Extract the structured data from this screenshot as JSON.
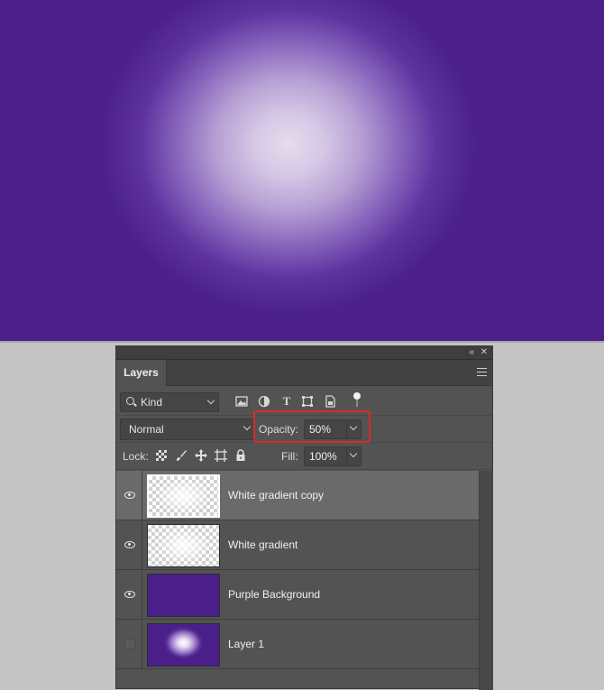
{
  "panel": {
    "tab_label": "Layers",
    "filter": {
      "kind_label": "Kind"
    },
    "blend": {
      "mode": "Normal",
      "opacity_label": "Opacity:",
      "opacity_value": "50%"
    },
    "lock": {
      "label": "Lock:",
      "fill_label": "Fill:",
      "fill_value": "100%"
    },
    "layers": [
      {
        "name": "White gradient copy",
        "visible": true,
        "selected": true,
        "thumbnail": "transparent-white-gradient"
      },
      {
        "name": "White gradient",
        "visible": true,
        "selected": false,
        "thumbnail": "transparent-white-gradient"
      },
      {
        "name": "Purple Background",
        "visible": true,
        "selected": false,
        "thumbnail": "solid-purple"
      },
      {
        "name": "Layer 1",
        "visible": false,
        "selected": false,
        "thumbnail": "purple-radial-glow"
      }
    ]
  },
  "colors": {
    "canvas_purple": "#4b2088",
    "highlight_red": "#d92a2a"
  },
  "icons": [
    "search-icon",
    "image-filter-icon",
    "adjustment-filter-icon",
    "type-filter-icon",
    "shape-filter-icon",
    "smart-object-filter-icon",
    "filter-toggle-icon",
    "lock-transparent-icon",
    "lock-image-icon",
    "lock-position-icon",
    "lock-artboard-icon",
    "lock-all-icon",
    "eye-icon"
  ]
}
